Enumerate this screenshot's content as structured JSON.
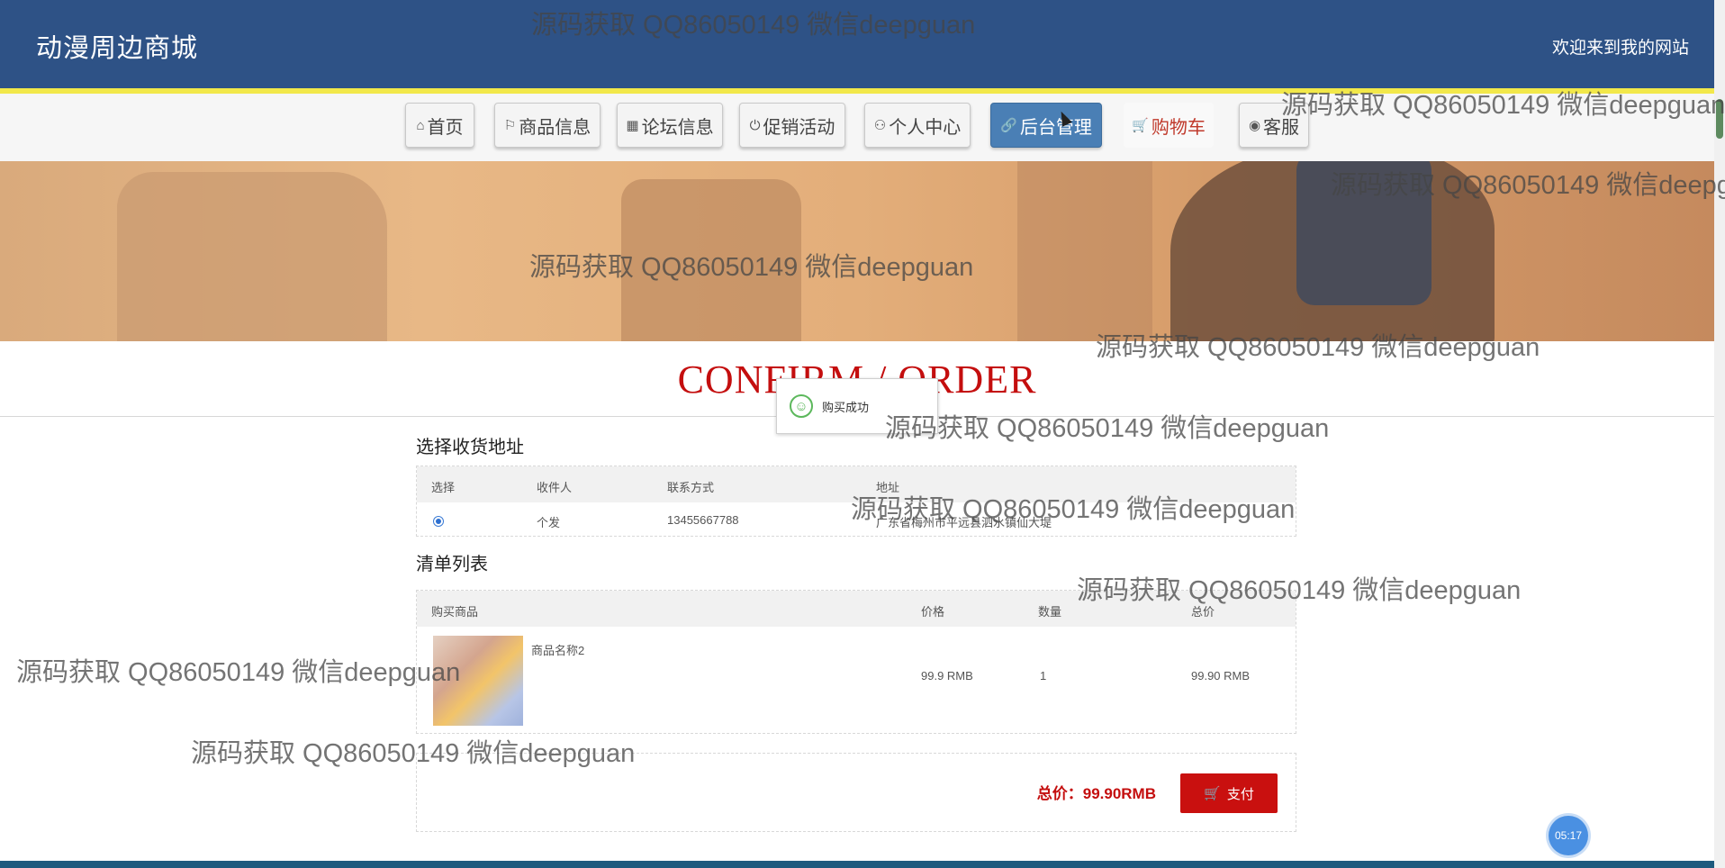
{
  "header": {
    "site_title": "动漫周边商城",
    "welcome": "欢迎来到我的网站"
  },
  "nav": [
    {
      "label": "首页",
      "icon": "home-icon",
      "glyph": "⌂"
    },
    {
      "label": "商品信息",
      "icon": "flag-icon",
      "glyph": "⚐"
    },
    {
      "label": "论坛信息",
      "icon": "grid-icon",
      "glyph": "▦"
    },
    {
      "label": "促销活动",
      "icon": "power-icon",
      "glyph": "⏻"
    },
    {
      "label": "个人中心",
      "icon": "user-icon",
      "glyph": "⚇"
    },
    {
      "label": "后台管理",
      "icon": "link-icon",
      "glyph": "🔗"
    },
    {
      "label": "购物车",
      "icon": "cart-icon",
      "glyph": "🛒"
    },
    {
      "label": "客服",
      "icon": "support-icon",
      "glyph": "◉"
    }
  ],
  "confirm_title": "CONFIRM / ORDER",
  "toast": {
    "text": "购买成功"
  },
  "address": {
    "section_title": "选择收货地址",
    "columns": [
      "选择",
      "收件人",
      "联系方式",
      "地址"
    ],
    "rows": [
      {
        "recipient": "个发",
        "phone": "13455667788",
        "address": "广东省梅州市平远县泗水镇仙大堤"
      }
    ]
  },
  "cart": {
    "section_title": "清单列表",
    "columns": [
      "购买商品",
      "价格",
      "数量",
      "总价"
    ],
    "items": [
      {
        "name": "商品名称2",
        "price": "99.9 RMB",
        "qty": "1",
        "total": "99.90 RMB"
      }
    ]
  },
  "summary": {
    "total_label": "总价：99.90RMB",
    "pay_label": "支付"
  },
  "timer": "05:17",
  "watermark": "源码获取 QQ86050149 微信deepguan",
  "colors": {
    "header_bg": "#2e5286",
    "accent_red": "#c40e0e",
    "active_nav": "#4a7fb5",
    "yellow_rule": "#f2e84a"
  }
}
